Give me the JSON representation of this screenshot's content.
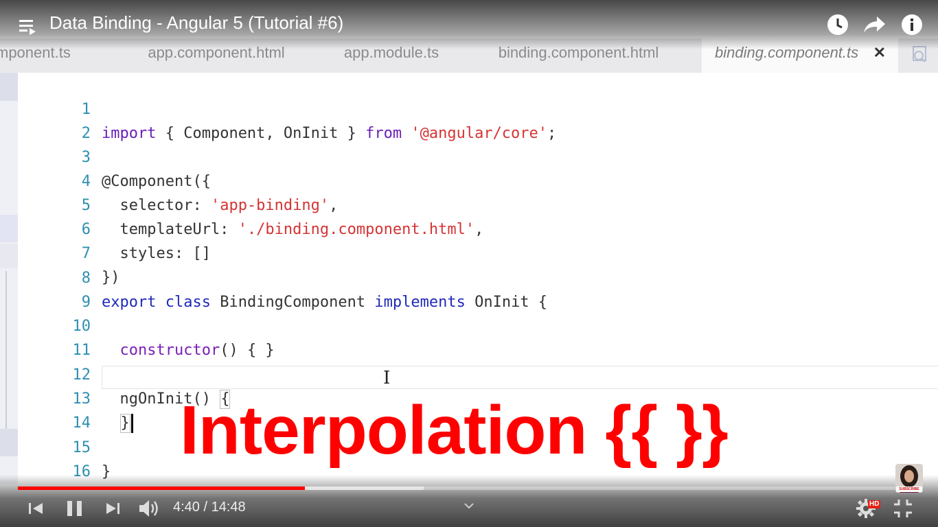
{
  "player": {
    "title": "Data Binding - Angular 5 (Tutorial #6)",
    "current_time": "4:40",
    "separator": " / ",
    "duration": "14:48",
    "progress_fraction": 0.318,
    "buffered_fraction": 0.45,
    "hd_label": "HD",
    "subscribe_label": "SUBSCRIBE",
    "accent_color": "#ff0000"
  },
  "editor": {
    "tabs": [
      {
        "label": "mponent.ts",
        "active": false
      },
      {
        "label": "app.component.html",
        "active": false
      },
      {
        "label": "app.module.ts",
        "active": false
      },
      {
        "label": "binding.component.html",
        "active": false
      },
      {
        "label": "binding.component.ts",
        "active": true
      }
    ],
    "close_symbol": "✕",
    "line_numbers": [
      "1",
      "2",
      "3",
      "4",
      "5",
      "6",
      "7",
      "8",
      "9",
      "10",
      "11",
      "12",
      "13",
      "14",
      "15",
      "16"
    ],
    "code": {
      "l1_import": "import",
      "l1_mid": " { Component, OnInit } ",
      "l1_from": "from",
      "l1_space": " ",
      "l1_str": "'@angular/core'",
      "l1_end": ";",
      "l3": "@Component({",
      "l4_key": "  selector: ",
      "l4_str": "'app-binding'",
      "l4_end": ",",
      "l5_key": "  templateUrl: ",
      "l5_str": "'./binding.component.html'",
      "l5_end": ",",
      "l6": "  styles: []",
      "l7": "})",
      "l8_export": "export",
      "l8_sp1": " ",
      "l8_class": "class",
      "l8_name": " BindingComponent ",
      "l8_impl": "implements",
      "l8_end": " OnInit {",
      "l10_indent": "  ",
      "l10_ctor": "constructor",
      "l10_end": "() { }",
      "l12_a": "  ngOnInit() ",
      "l12_brace": "{",
      "l13_indent": "  ",
      "l13_brace": "}",
      "l15": "}"
    }
  },
  "overlay_text": "Interpolation {{ }}"
}
